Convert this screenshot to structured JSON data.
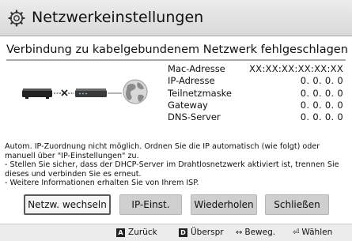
{
  "dialog": {
    "title": "Netzwerkeinstellungen",
    "icon": "gear-icon",
    "subtitle": "Verbindung zu kabelgebundenem Netzwerk fehlgeschlagen"
  },
  "network_info": [
    {
      "label": "Mac-Adresse",
      "value": "XX:XX:XX:XX:XX:XX"
    },
    {
      "label": "IP-Adresse",
      "value": "0.  0.  0.  0"
    },
    {
      "label": "Teilnetzmaske",
      "value": "0.  0.  0.  0"
    },
    {
      "label": "Gateway",
      "value": "0.  0.  0.  0"
    },
    {
      "label": "DNS-Server",
      "value": "0.  0.  0.  0"
    }
  ],
  "message": {
    "line1": "Autom. IP-Zuordnung nicht möglich. Ordnen Sie die IP automatisch (wie folgt) oder",
    "line2": "manuell über \"IP-Einstellungen\" zu.",
    "line3": "- Stellen Sie sicher, dass der DHCP-Server im Drahtlosnetzwerk aktiviert ist, trennen Sie",
    "line4": "dieses und verbinden Sie es erneut.",
    "line5": "- Weitere Informationen erhalten Sie von Ihrem ISP."
  },
  "buttons": {
    "change_network": "Netzw. wechseln",
    "ip_settings": "IP-Einst.",
    "retry": "Wiederholen",
    "close": "Schließen"
  },
  "footer": {
    "back_key": "A",
    "back_label": "Zurück",
    "skip_key": "D",
    "skip_label": "Überspr",
    "move_glyph": "↔",
    "move_label": "Beweg.",
    "select_glyph": "⏎",
    "select_label": "Wählen"
  },
  "colors": {
    "title_bar": "#e3e3e3",
    "button_normal": "#cfcfcf",
    "button_active_border": "#5a5a5a",
    "footer": "#ececec"
  }
}
